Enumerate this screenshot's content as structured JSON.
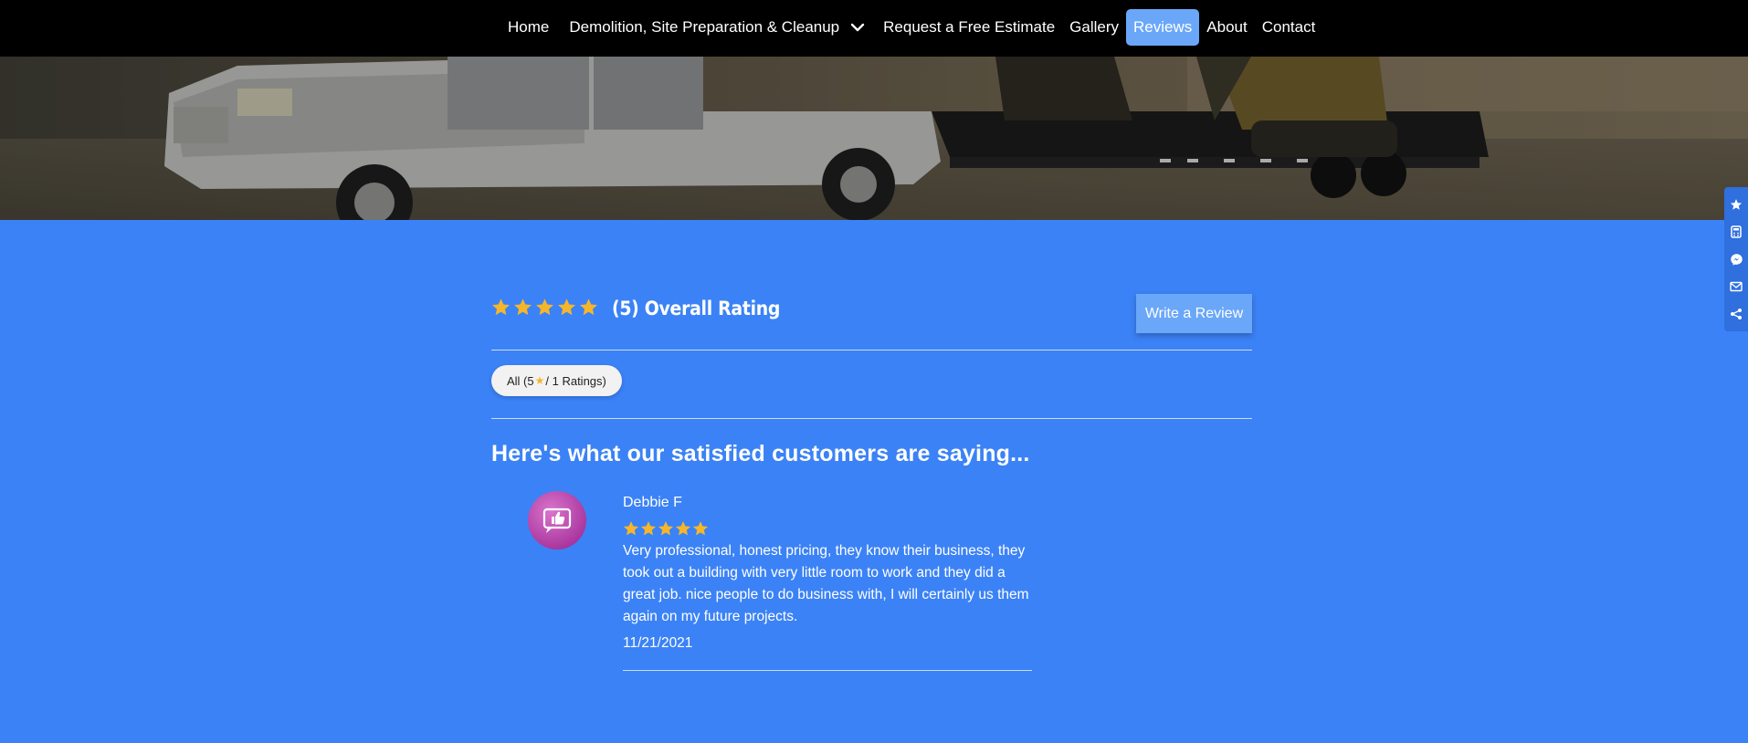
{
  "nav": {
    "items": [
      {
        "label": "Home"
      },
      {
        "label": "Demolition, Site Preparation & Cleanup",
        "has_dropdown": true
      },
      {
        "label": "Request a Free Estimate"
      },
      {
        "label": "Gallery"
      },
      {
        "label": "Reviews",
        "active": true
      },
      {
        "label": "About"
      },
      {
        "label": "Contact"
      }
    ]
  },
  "side_tabs": [
    "star-icon",
    "calculator-icon",
    "messenger-icon",
    "mail-icon",
    "share-icon"
  ],
  "summary": {
    "rating": 5,
    "stars": 5,
    "overall_label": "(5) Overall Rating",
    "write_review_label": "Write a Review"
  },
  "filter": {
    "prefix": "All (5",
    "suffix": "/ 1 Ratings)"
  },
  "section_title": "Here's what our satisfied customers are saying...",
  "reviews": [
    {
      "name": "Debbie F",
      "stars": 5,
      "text": "Very professional, honest pricing, they know their business, they took out a building with very little room to work and they did a great job. nice people to do business with, I will certainly us them again on my future projects.",
      "date": "11/21/2021"
    }
  ],
  "colors": {
    "page_background": "#3b82f6",
    "nav_background": "#000000",
    "active_nav": "#6aa7f9",
    "star": "#f5b62a",
    "avatar": "#b844a8"
  }
}
